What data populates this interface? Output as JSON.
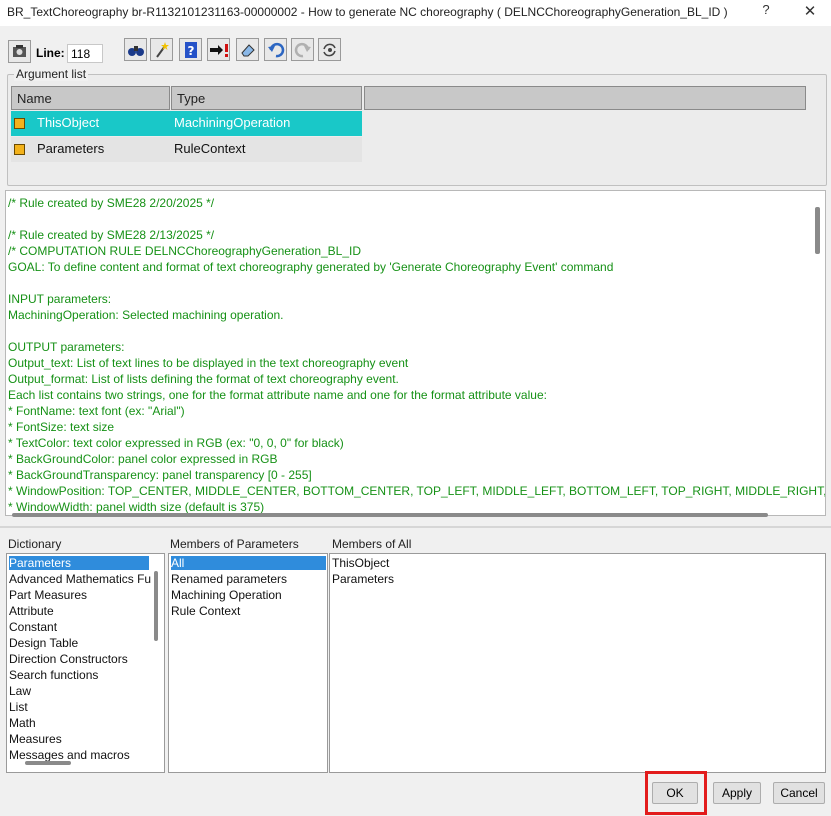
{
  "window": {
    "title": "BR_TextChoreography br-R1132101231163-00000002 - How to generate NC choreography  ( DELNCChoreographyGeneration_BL_ID )",
    "help_label": "?",
    "close_label": "✕"
  },
  "toolbar": {
    "line_label": "Line:",
    "line_value": "118",
    "icons": [
      "settings-icon",
      "find-icon",
      "magic-wand-icon",
      "help-book-icon",
      "goto-error-icon",
      "eraser-icon",
      "undo-icon",
      "redo-icon",
      "replace-icon"
    ]
  },
  "argument_list": {
    "legend": "Argument list",
    "headers": [
      "Name",
      "Type"
    ],
    "rows": [
      {
        "name": "ThisObject",
        "type": "MachiningOperation",
        "selected": true
      },
      {
        "name": "Parameters",
        "type": "RuleContext",
        "selected": false
      }
    ]
  },
  "editor": {
    "lines": [
      "/* Rule created by SME28 2/20/2025 */",
      "",
      "/* Rule created by SME28 2/13/2025 */",
      "/* COMPUTATION RULE DELNCChoreographyGeneration_BL_ID",
      "GOAL: To define content and format of text choreography generated by 'Generate Choreography Event' command",
      "",
      "INPUT parameters:",
      "MachiningOperation: Selected machining operation.",
      "",
      "OUTPUT parameters:",
      "Output_text: List of text lines to be displayed in the text choreography event",
      "Output_format: List of lists defining the format of text choreography event.",
      "Each list contains two strings, one for the format attribute name and one for the format attribute value:",
      "* FontName: text font (ex: \"Arial\")",
      "* FontSize: text size",
      "* TextColor: text color expressed in RGB (ex: \"0, 0, 0\" for black)",
      "* BackGroundColor: panel color expressed in RGB",
      "* BackGroundTransparency: panel transparency [0 - 255]",
      "* WindowPosition: TOP_CENTER, MIDDLE_CENTER, BOTTOM_CENTER, TOP_LEFT, MIDDLE_LEFT, BOTTOM_LEFT, TOP_RIGHT, MIDDLE_RIGHT, BOTTOM_RI",
      "* WindowWidth: panel width size (default is 375)"
    ],
    "text_color": "#169116"
  },
  "dictionary": {
    "title": "Dictionary",
    "items": [
      "Parameters",
      "Advanced Mathematics Fu",
      "Part Measures",
      "Attribute",
      "Constant",
      "Design Table",
      "Direction Constructors",
      "Search functions",
      "Law",
      "List",
      "Math",
      "Measures",
      "Messages and macros"
    ],
    "selected_index": 0
  },
  "members_of_parameters": {
    "title": "Members of Parameters",
    "items": [
      "All",
      "Renamed parameters",
      "Machining Operation",
      "Rule Context"
    ],
    "selected_index": 0
  },
  "members_of_all": {
    "title": "Members of All",
    "items": [
      "ThisObject",
      "Parameters"
    ]
  },
  "buttons": {
    "ok": "OK",
    "apply": "Apply",
    "cancel": "Cancel"
  },
  "colors": {
    "selection_cyan": "#19c8c8",
    "list_selection_blue": "#2f8cdc",
    "highlight_red": "#e21c1c"
  }
}
